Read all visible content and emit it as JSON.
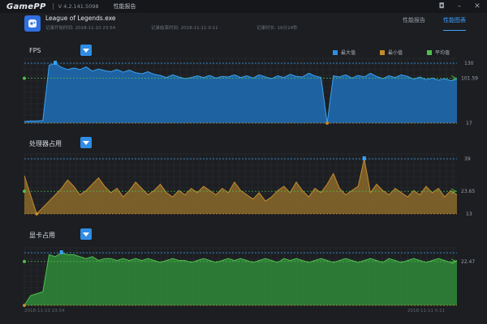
{
  "titlebar": {
    "logo": "GamePP",
    "version": "V 4.2.141.5098",
    "window_title": "性能报告"
  },
  "header": {
    "app_name": "League of Legends.exe",
    "start_time": "记录开始时间: 2018-11-10 23:54",
    "end_time": "记录结束时间: 2018-11-11 0:11",
    "duration": "记录时长: 16分24秒"
  },
  "tabs": [
    {
      "label": "性能报告",
      "active": false
    },
    {
      "label": "性能图表",
      "active": true
    }
  ],
  "legend": [
    {
      "label": "最大值",
      "color": "#2f8de6"
    },
    {
      "label": "最小值",
      "color": "#c58a2c"
    },
    {
      "label": "平均值",
      "color": "#4fbf4a"
    }
  ],
  "charts": [
    {
      "label": "FPS",
      "color_fill": "#1f6fb8",
      "color_line": "#3aa2f0",
      "marker_color": "#2f8de6",
      "axis_max": "130",
      "axis_avg": "101.59",
      "axis_min": "17",
      "max": 130,
      "min": 17,
      "avg": 101.59,
      "values": [
        20,
        21,
        21,
        22,
        126,
        130,
        122,
        118,
        121,
        118,
        123,
        115,
        119,
        116,
        114,
        118,
        113,
        117,
        112,
        110,
        114,
        109,
        107,
        103,
        108,
        104,
        101,
        103,
        106,
        103,
        107,
        102,
        105,
        104,
        108,
        103,
        106,
        102,
        108,
        104,
        101,
        106,
        103,
        109,
        105,
        104,
        111,
        106,
        103,
        17,
        106,
        104,
        108,
        102,
        107,
        104,
        111,
        105,
        101,
        106,
        103,
        108,
        105,
        100,
        104,
        99,
        102,
        98,
        101,
        97,
        100
      ]
    },
    {
      "label": "处理器占用",
      "color_fill": "#8a6a2a",
      "color_line": "#c58a2c",
      "marker_color": "#c58a2c",
      "axis_max": "39",
      "axis_avg": "23.65",
      "axis_min": "13",
      "max": 39,
      "min": 13,
      "avg": 23.65,
      "values": [
        31,
        22,
        13,
        16,
        19,
        22,
        25,
        29,
        26,
        22,
        24,
        27,
        30,
        26,
        23,
        25,
        21,
        24,
        28,
        25,
        22,
        24,
        27,
        23,
        21,
        24,
        22,
        25,
        23,
        26,
        24,
        22,
        25,
        23,
        28,
        24,
        22,
        20,
        23,
        19,
        21,
        24,
        26,
        23,
        28,
        24,
        21,
        25,
        23,
        27,
        32,
        25,
        22,
        24,
        26,
        39,
        23,
        27,
        24,
        22,
        25,
        23,
        21,
        24,
        22,
        26,
        23,
        25,
        21,
        24,
        22
      ]
    },
    {
      "label": "显卡占用",
      "color_fill": "#2f8a3a",
      "color_line": "#4fbf4a",
      "marker_color": "#4fbf4a",
      "axis_max": "",
      "axis_avg": "22.47",
      "axis_min": "",
      "max": 27,
      "min": 0,
      "avg": 22.47,
      "values": [
        0,
        5,
        6,
        7,
        26,
        25,
        27,
        26,
        26,
        25,
        24,
        25,
        23,
        24,
        24,
        23,
        24,
        23,
        24,
        23,
        24,
        23,
        22,
        23,
        24,
        23,
        23,
        22,
        23,
        24,
        23,
        22,
        23,
        24,
        23,
        24,
        23,
        22,
        23,
        24,
        23,
        22,
        24,
        23,
        24,
        23,
        22,
        23,
        24,
        23,
        22,
        23,
        24,
        23,
        22,
        23,
        24,
        23,
        22,
        24,
        23,
        22,
        23,
        24,
        23,
        22,
        23,
        24,
        23,
        22,
        23
      ]
    }
  ],
  "bottom": {
    "start": "2018-11-10 23:54",
    "end": "2018-11-11 0:11"
  }
}
